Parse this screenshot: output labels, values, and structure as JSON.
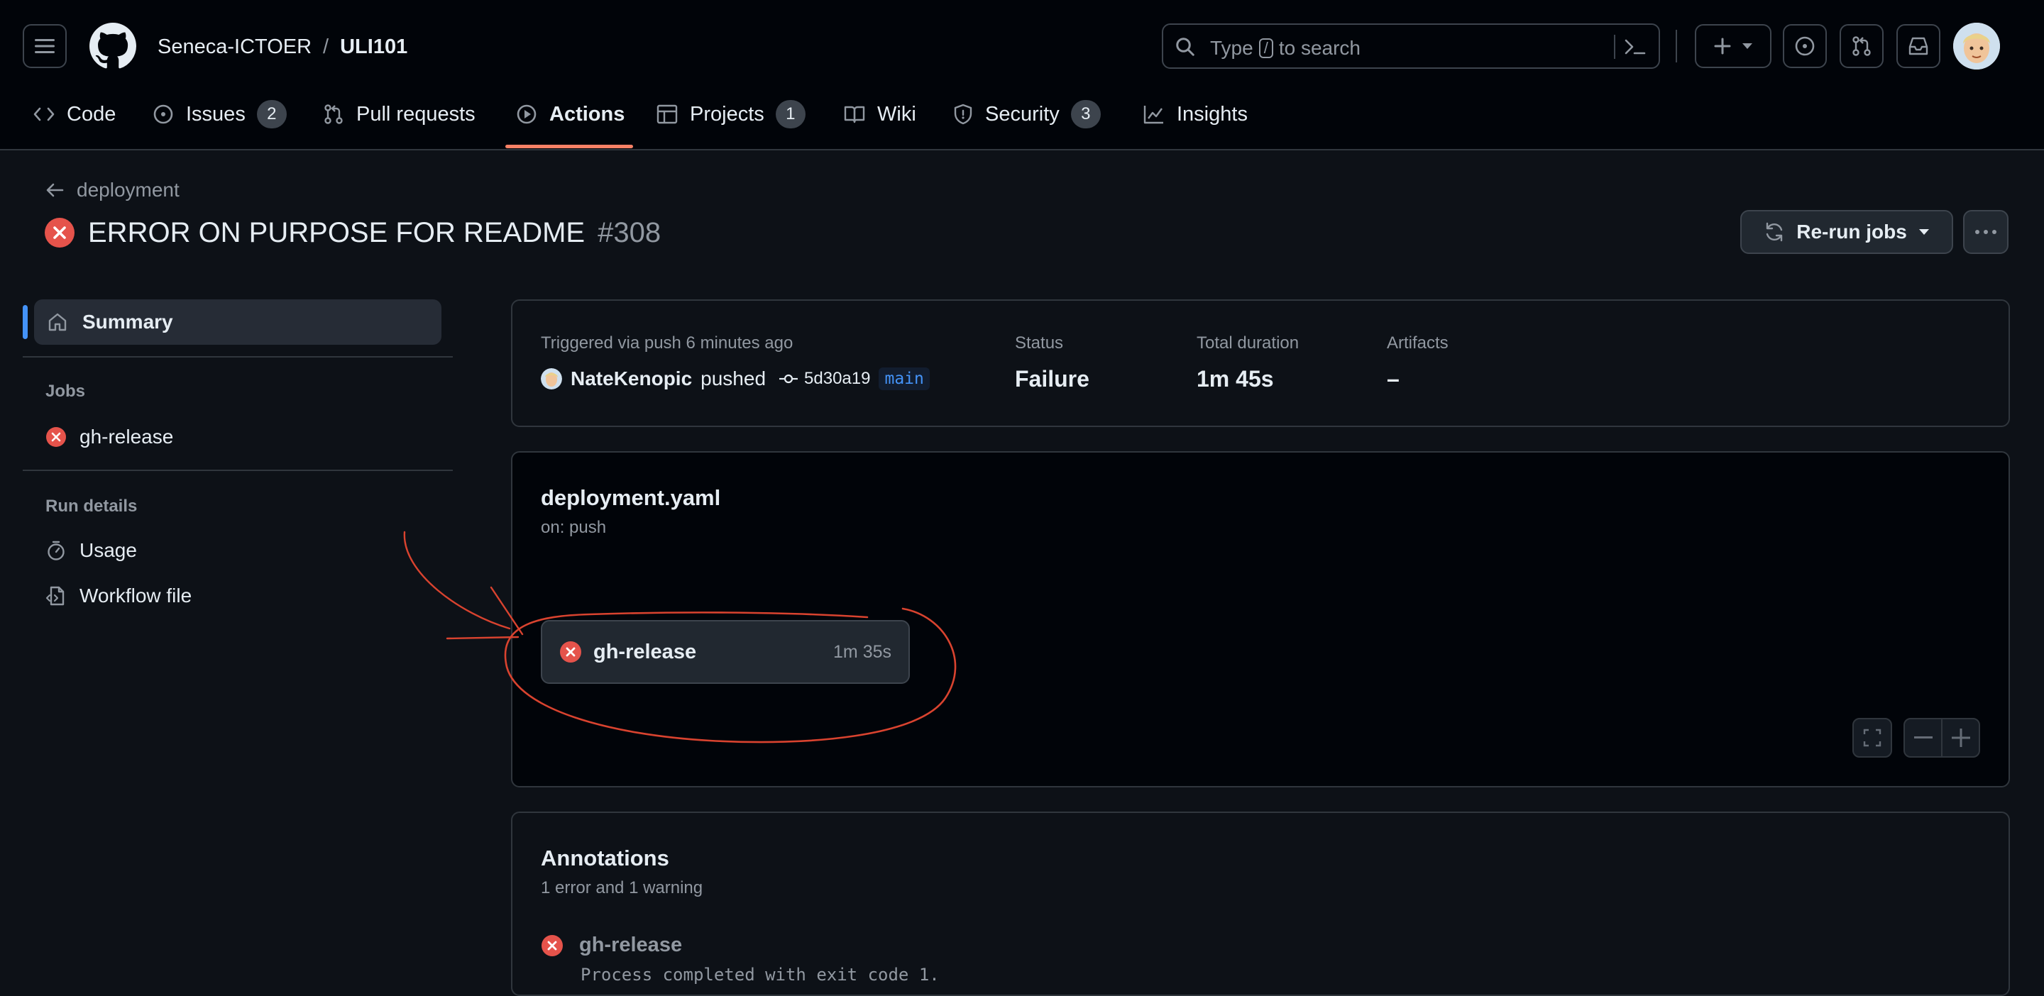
{
  "header": {
    "owner": "Seneca-ICTOER",
    "separator": "/",
    "repo": "ULI101",
    "search": {
      "text_before": "Type",
      "shortcut_key": "/",
      "text_after": "to search"
    }
  },
  "nav_tabs": [
    {
      "label": "Code",
      "icon": "code-icon"
    },
    {
      "label": "Issues",
      "count": "2",
      "icon": "issue-opened-icon"
    },
    {
      "label": "Pull requests",
      "icon": "git-pull-request-icon"
    },
    {
      "label": "Actions",
      "icon": "play-icon",
      "active": true
    },
    {
      "label": "Projects",
      "count": "1",
      "icon": "table-icon"
    },
    {
      "label": "Wiki",
      "icon": "book-icon"
    },
    {
      "label": "Security",
      "count": "3",
      "icon": "shield-icon"
    },
    {
      "label": "Insights",
      "icon": "graph-icon"
    }
  ],
  "run": {
    "back_label": "deployment",
    "title": "ERROR ON PURPOSE FOR README",
    "number": "#308",
    "rerun_label": "Re-run jobs"
  },
  "sidebar": {
    "summary_label": "Summary",
    "jobs_heading": "Jobs",
    "job_label": "gh-release",
    "run_details_heading": "Run details",
    "usage_label": "Usage",
    "workflow_file_label": "Workflow file"
  },
  "summary_card": {
    "trigger_text": "Triggered via push 6 minutes ago",
    "actor": "NateKenopic",
    "action": "pushed",
    "sha": "5d30a19",
    "branch": "main",
    "status_label": "Status",
    "status_value": "Failure",
    "duration_label": "Total duration",
    "duration_value": "1m 45s",
    "artifacts_label": "Artifacts",
    "artifacts_value": "–"
  },
  "workflow_card": {
    "filename": "deployment.yaml",
    "trigger": "on: push",
    "job_name": "gh-release",
    "job_duration": "1m 35s"
  },
  "annotations_card": {
    "title": "Annotations",
    "subtitle": "1 error and 1 warning",
    "items": [
      {
        "job": "gh-release",
        "message": "Process completed with exit code 1."
      }
    ]
  },
  "colors": {
    "background": "#0d1117",
    "header_bg": "#010409",
    "accent_blue": "#4493f8",
    "error_red": "#e5534b",
    "tab_underline": "#f78166",
    "annotation_ink": "#d9432f"
  }
}
